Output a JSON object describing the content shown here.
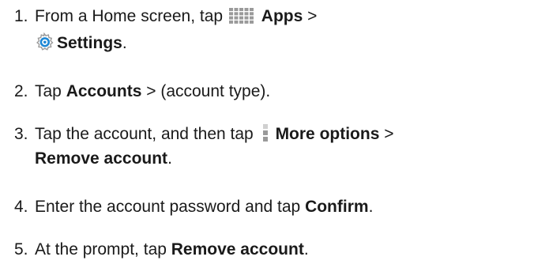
{
  "steps": [
    {
      "number": "1.",
      "line1": {
        "a": "From a Home screen, tap",
        "apps_icon": "apps-icon",
        "apps_label": "Apps",
        "sep": " >"
      },
      "line2": {
        "settings_icon": "settings-icon",
        "settings_label": "Settings",
        "end": "."
      }
    },
    {
      "number": "2.",
      "a": "Tap ",
      "accounts_label": "Accounts",
      "b": " > (account type)."
    },
    {
      "number": "3.",
      "line1": {
        "a": "Tap the account, and then tap",
        "more_icon": "more-options-icon",
        "more_label": "More options",
        "sep": " >"
      },
      "line2": {
        "remove_label": "Remove account",
        "end": "."
      }
    },
    {
      "number": "4.",
      "a": "Enter the account password and tap ",
      "confirm_label": "Confirm",
      "end": "."
    },
    {
      "number": "5.",
      "a": "At the prompt, tap ",
      "remove_label": "Remove account",
      "end": "."
    }
  ],
  "colors": {
    "text": "#1a1a1a",
    "settings_icon_blue": "#1e88d6",
    "icon_gray": "#9a9a9a",
    "more_icon_light": "#d0d0d0"
  }
}
